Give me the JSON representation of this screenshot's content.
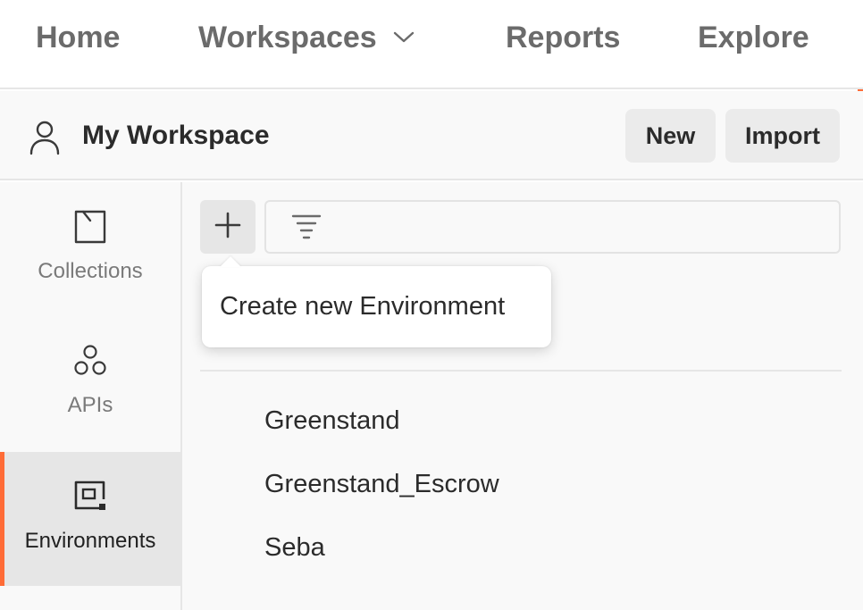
{
  "topnav": {
    "home": "Home",
    "workspaces": "Workspaces",
    "reports": "Reports",
    "explore": "Explore"
  },
  "workspace": {
    "title": "My Workspace",
    "new_label": "New",
    "import_label": "Import"
  },
  "sidebar": {
    "tabs": [
      {
        "label": "Collections",
        "icon": "collections-icon",
        "active": false
      },
      {
        "label": "APIs",
        "icon": "apis-icon",
        "active": false
      },
      {
        "label": "Environments",
        "icon": "environments-icon",
        "active": true
      }
    ]
  },
  "main": {
    "filter_placeholder": "",
    "tooltip": "Create new Environment",
    "environments": [
      "Greenstand",
      "Greenstand_Escrow",
      "Seba"
    ]
  },
  "colors": {
    "accent": "#ff6c37",
    "panel_bg": "#f9f9f9",
    "active_tab_bg": "#e6e6e6"
  }
}
